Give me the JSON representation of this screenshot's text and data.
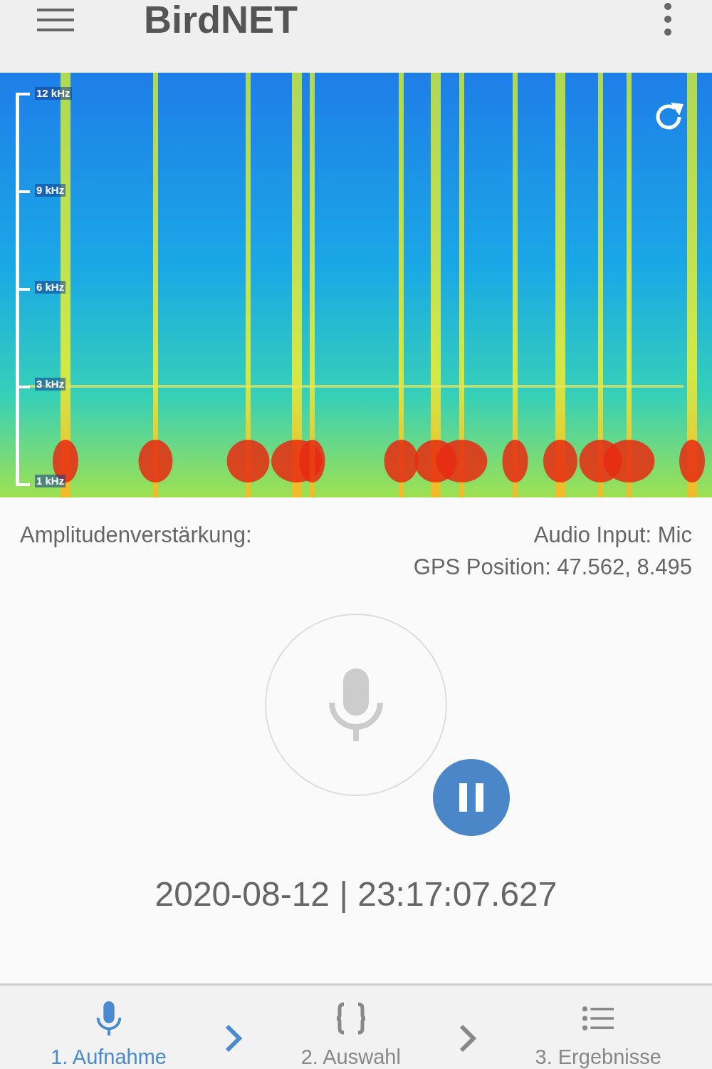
{
  "app_bar": {
    "title": "BirdNET"
  },
  "spectrogram": {
    "axis_labels": [
      "12 kHz",
      "9 kHz",
      "6 kHz",
      "3 kHz",
      "1 kHz"
    ]
  },
  "info": {
    "gain_label": "Amplitudenverstärkung:",
    "audio_input": "Audio Input: Mic",
    "gps": "GPS Position: 47.562, 8.495"
  },
  "recorder": {
    "recording": true
  },
  "timestamp": "2020-08-12 | 23:17:07.627",
  "steps": [
    {
      "label": "1. Aufnahme",
      "kind": "mic",
      "selected": true
    },
    {
      "label": "2. Auswahl",
      "kind": "braces",
      "selected": false
    },
    {
      "label": "3. Ergebnisse",
      "kind": "list",
      "selected": false
    }
  ]
}
